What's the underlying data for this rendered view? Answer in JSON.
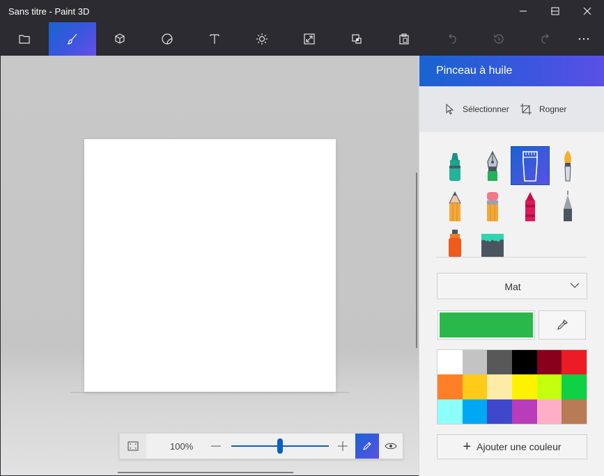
{
  "window": {
    "title": "Sans titre - Paint 3D"
  },
  "toolbar": {
    "tools": [
      {
        "name": "menu",
        "icon": "folder-icon",
        "active": false
      },
      {
        "name": "brushes",
        "icon": "brush-icon",
        "active": true
      },
      {
        "name": "3d-shapes",
        "icon": "cube-icon",
        "active": false
      },
      {
        "name": "stickers",
        "icon": "sticker-icon",
        "active": false
      },
      {
        "name": "text",
        "icon": "text-icon",
        "active": false
      },
      {
        "name": "effects",
        "icon": "sun-icon",
        "active": false
      },
      {
        "name": "canvas",
        "icon": "resize-icon",
        "active": false
      },
      {
        "name": "remix3d",
        "icon": "remix-icon",
        "active": false
      },
      {
        "name": "paste",
        "icon": "clipboard-icon",
        "active": false
      },
      {
        "name": "undo",
        "icon": "undo-icon",
        "active": false
      },
      {
        "name": "history",
        "icon": "history-icon",
        "active": false
      },
      {
        "name": "redo",
        "icon": "redo-icon",
        "active": false
      },
      {
        "name": "more",
        "icon": "more-icon",
        "active": false
      }
    ]
  },
  "zoom": {
    "value_label": "100%",
    "level": 0.5
  },
  "panel": {
    "title": "Pinceau à huile",
    "select_label": "Sélectionner",
    "crop_label": "Rogner",
    "brushes": [
      {
        "name": "marker",
        "icon": "marker-icon"
      },
      {
        "name": "calligraphy-pen",
        "icon": "calligraphy-pen-icon"
      },
      {
        "name": "oil-brush",
        "icon": "oil-brush-icon",
        "selected": true
      },
      {
        "name": "watercolor",
        "icon": "watercolor-icon"
      },
      {
        "name": "pencil",
        "icon": "pencil-icon"
      },
      {
        "name": "eraser",
        "icon": "eraser-icon"
      },
      {
        "name": "crayon",
        "icon": "crayon-icon"
      },
      {
        "name": "pixel-pen",
        "icon": "pixel-pen-icon"
      },
      {
        "name": "spray-can",
        "icon": "spray-can-icon"
      },
      {
        "name": "fill",
        "icon": "fill-bucket-icon"
      }
    ],
    "finish_value": "Mat",
    "current_color": "#2ab84a",
    "palette": [
      "#ffffff",
      "#c3c3c3",
      "#585858",
      "#000000",
      "#88001b",
      "#ec1c24",
      "#ff7f27",
      "#ffca18",
      "#fdeca6",
      "#fff200",
      "#c4ff0e",
      "#0ed145",
      "#8cfffb",
      "#00a8f3",
      "#3f48cc",
      "#b83dba",
      "#ffaec8",
      "#b97a56"
    ],
    "add_color_label": "Ajouter une couleur"
  }
}
